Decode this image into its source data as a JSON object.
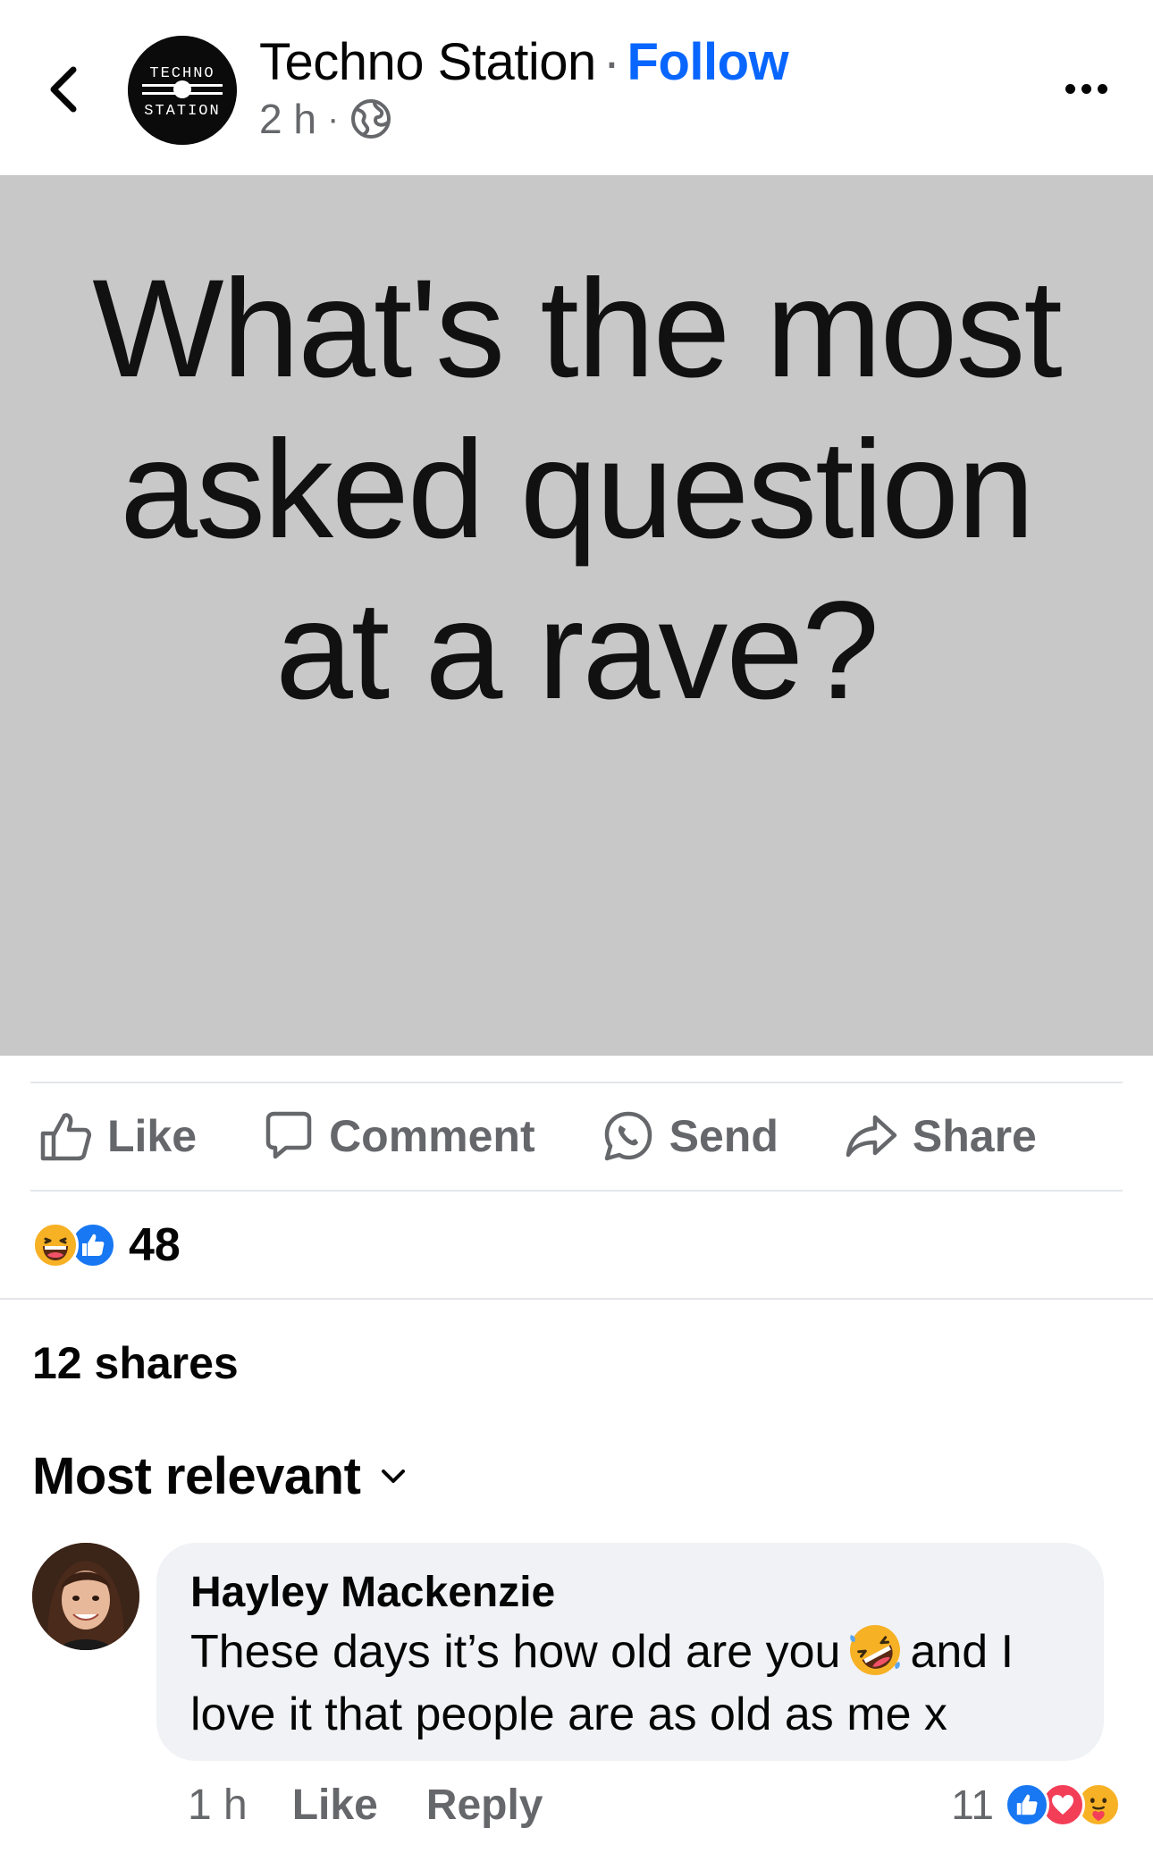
{
  "header": {
    "page_name": "Techno Station",
    "separator": "·",
    "follow_label": "Follow",
    "time": "2 h",
    "meta_separator": "·",
    "logo_text_top": "TECHNO",
    "logo_text_bottom": "STATION",
    "audience_icon": "globe-icon"
  },
  "post": {
    "image_lines": [
      "What's the most",
      "asked question",
      "at a rave?"
    ],
    "image_background": "#c8c8c8"
  },
  "actions": [
    {
      "label": "Like",
      "icon": "thumbs-up-icon"
    },
    {
      "label": "Comment",
      "icon": "comment-icon"
    },
    {
      "label": "Send",
      "icon": "whatsapp-icon"
    },
    {
      "label": "Share",
      "icon": "share-arrow-icon"
    }
  ],
  "reactions": {
    "types": [
      "haha",
      "like"
    ],
    "count": "48"
  },
  "shares": "12 shares",
  "sort": {
    "label": "Most relevant",
    "icon": "chevron-down-icon"
  },
  "comment": {
    "author": "Hayley Mackenzie",
    "text_before_emoji": "These days it’s how old are you",
    "emoji": "rolling-on-floor-laughing",
    "text_after_emoji": "and I love it that people are as old as me x",
    "time": "1 h",
    "like_label": "Like",
    "reply_label": "Reply",
    "reaction_count": "11",
    "reaction_types": [
      "like",
      "love",
      "care"
    ]
  },
  "colors": {
    "accent": "#0866ff",
    "secondary_text": "#65676b",
    "like_blue": "#1877f2",
    "love_red": "#f33e58",
    "haha_yellow": "#f7b125",
    "bubble_bg": "#f0f2f5"
  }
}
